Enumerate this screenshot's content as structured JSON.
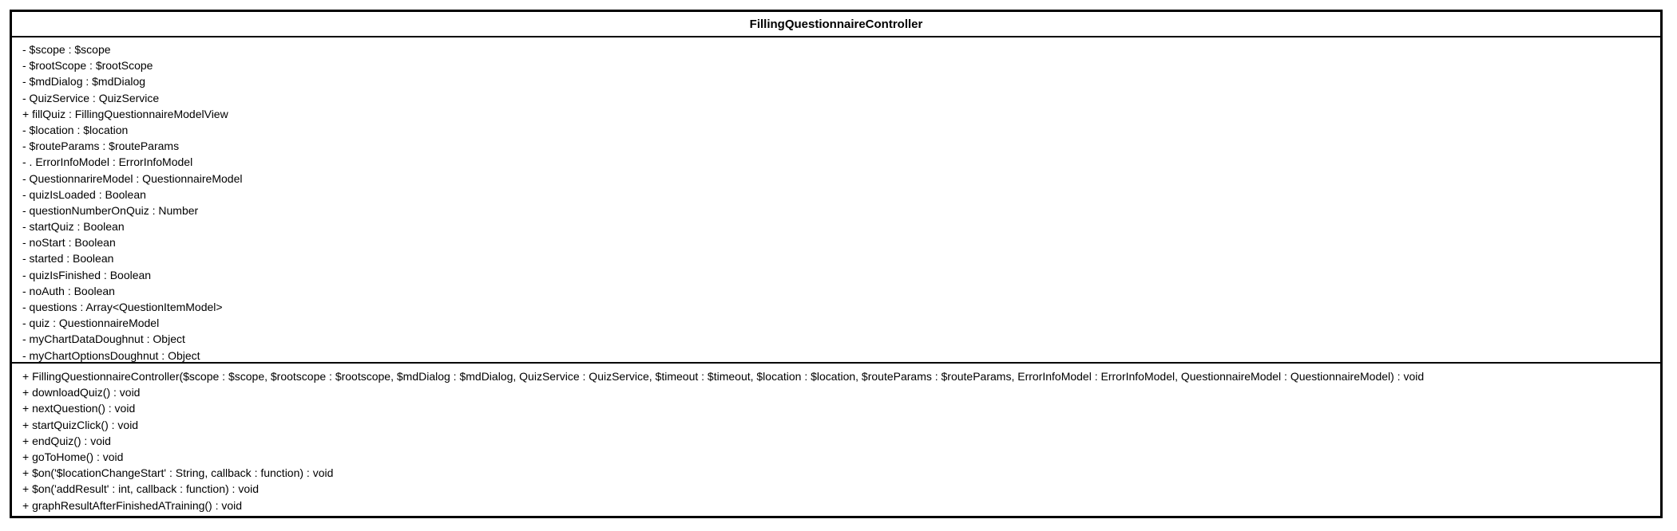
{
  "class_name": "FillingQuestionnaireController",
  "attributes": [
    "- $scope : $scope",
    "- $rootScope : $rootScope",
    "- $mdDialog : $mdDialog",
    "- QuizService : QuizService",
    "+ fillQuiz : FillingQuestionnaireModelView",
    "- $location : $location",
    "- $routeParams : $routeParams",
    "- . ErrorInfoModel : ErrorInfoModel",
    "- QuestionnarireModel : QuestionnaireModel",
    "- quizIsLoaded : Boolean",
    "- questionNumberOnQuiz : Number",
    "- startQuiz : Boolean",
    "- noStart : Boolean",
    "- started : Boolean",
    "- quizIsFinished : Boolean",
    "- noAuth : Boolean",
    "- questions : Array<QuestionItemModel>",
    "- quiz : QuestionnaireModel",
    "- myChartDataDoughnut : Object",
    "- myChartOptionsDoughnut : Object"
  ],
  "operations": [
    "+ FillingQuestionnaireController($scope : $scope, $rootscope : $rootscope, $mdDialog : $mdDialog, QuizService : QuizService, $timeout : $timeout, $location : $location, $routeParams : $routeParams, ErrorInfoModel : ErrorInfoModel, QuestionnaireModel : QuestionnaireModel) : void",
    "+ downloadQuiz() : void",
    "+ nextQuestion() : void",
    "+ startQuizClick() : void",
    "+ endQuiz() : void",
    "+ goToHome() : void",
    "+ $on('$locationChangeStart' : String, callback : function) : void",
    "+ $on('addResult' : int, callback : function) : void",
    "+ graphResultAfterFinishedATraining() : void"
  ]
}
